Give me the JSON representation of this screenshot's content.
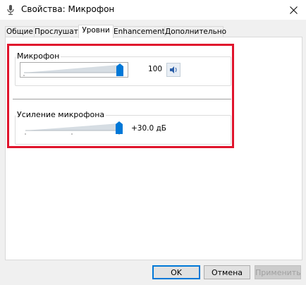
{
  "window": {
    "title": "Свойства: Микрофон"
  },
  "tabs": [
    {
      "label": "Общие"
    },
    {
      "label": "Прослушать"
    },
    {
      "label": "Уровни"
    },
    {
      "label": "Enhancements"
    },
    {
      "label": "Дополнительно"
    }
  ],
  "active_tab": "Уровни",
  "levels": {
    "microphone": {
      "label": "Микрофон",
      "value": "100",
      "level": 1.0,
      "mute_icon": "speaker-icon"
    },
    "boost": {
      "label": "Усиление микрофона",
      "value": "+30.0 дБ",
      "level": 1.0
    }
  },
  "buttons": {
    "ok": "OK",
    "cancel": "Отмена",
    "apply": "Применить"
  },
  "colors": {
    "accent": "#0078d7",
    "highlight": "#e0142c"
  }
}
